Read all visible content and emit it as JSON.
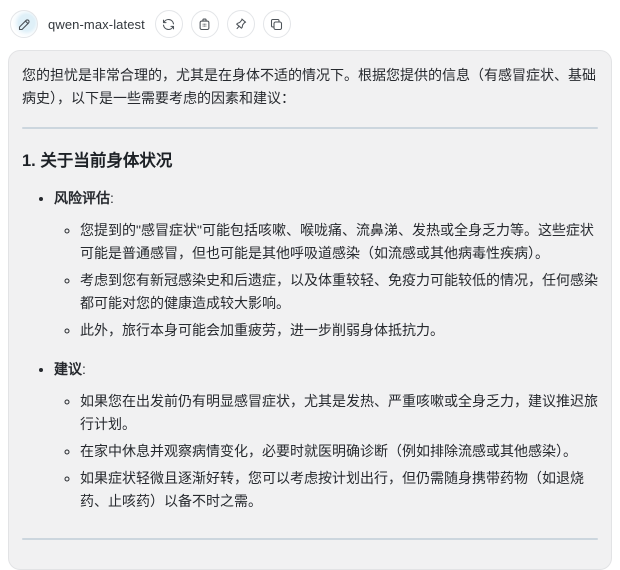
{
  "toolbar": {
    "model_name": "qwen-max-latest",
    "edit_tooltip": "edit",
    "regenerate_tooltip": "regenerate",
    "delete_tooltip": "delete",
    "pin_tooltip": "pin",
    "copy_tooltip": "copy"
  },
  "colors": {
    "card_background": "#f1f1f2",
    "card_border": "#e2e3e5",
    "divider": "#ccd6de",
    "text": "#26292e",
    "icon": "#4d5359"
  },
  "message": {
    "intro": "您的担忧是非常合理的，尤其是在身体不适的情况下。根据您提供的信息（有感冒症状、基础病史），以下是一些需要考虑的因素和建议：",
    "section1": {
      "heading": "1. 关于当前身体状况",
      "bullets": [
        {
          "label": "风险评估",
          "suffix": ":",
          "sub": [
            "您提到的\"感冒症状\"可能包括咳嗽、喉咙痛、流鼻涕、发热或全身乏力等。这些症状可能是普通感冒，但也可能是其他呼吸道感染（如流感或其他病毒性疾病）。",
            "考虑到您有新冠感染史和后遗症，以及体重较轻、免疫力可能较低的情况，任何感染都可能对您的健康造成较大影响。",
            "此外，旅行本身可能会加重疲劳，进一步削弱身体抵抗力。"
          ]
        },
        {
          "label": "建议",
          "suffix": ":",
          "sub": [
            "如果您在出发前仍有明显感冒症状，尤其是发热、严重咳嗽或全身乏力，建议推迟旅行计划。",
            "在家中休息并观察病情变化，必要时就医明确诊断（例如排除流感或其他感染）。",
            "如果症状轻微且逐渐好转，您可以考虑按计划出行，但仍需随身携带药物（如退烧药、止咳药）以备不时之需。"
          ]
        }
      ]
    }
  }
}
